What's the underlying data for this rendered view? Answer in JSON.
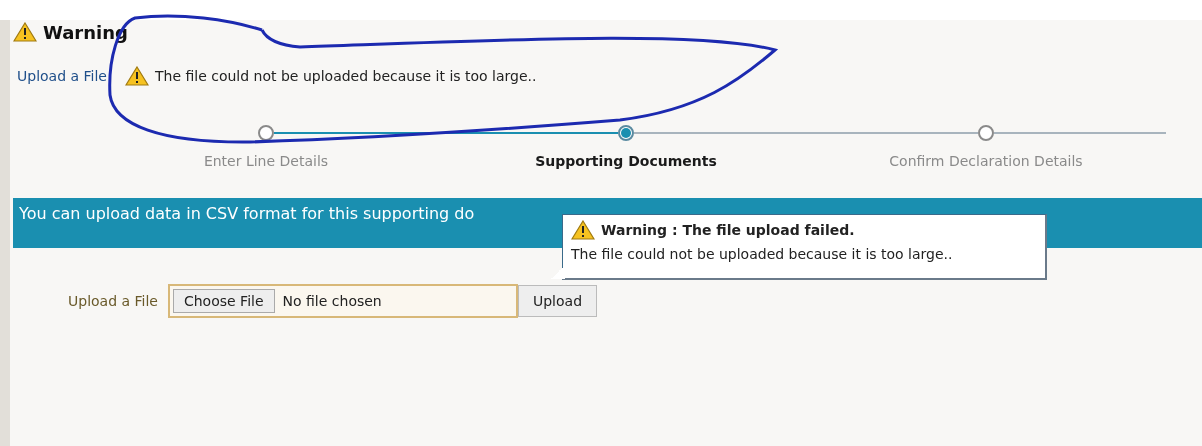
{
  "heading": {
    "title": "Warning"
  },
  "message": {
    "link": "Upload a File",
    "text": "The file could not be uploaded because it is too large.."
  },
  "steps": [
    {
      "label": "Enter Line Details",
      "selected": false,
      "completed": true
    },
    {
      "label": "Supporting Documents",
      "selected": true,
      "completed": false
    },
    {
      "label": "Confirm Declaration Details",
      "selected": false,
      "completed": false
    }
  ],
  "banner": {
    "text": "You can upload data in CSV format for this supporting do"
  },
  "upload": {
    "label": "Upload a File",
    "choose_button": "Choose File",
    "file_status": "No file chosen",
    "upload_button": "Upload"
  },
  "tooltip": {
    "title": "Warning : The file upload failed.",
    "text": "The file could not be uploaded because it is too large.."
  },
  "annotation": {
    "kind": "freehand-loop"
  }
}
